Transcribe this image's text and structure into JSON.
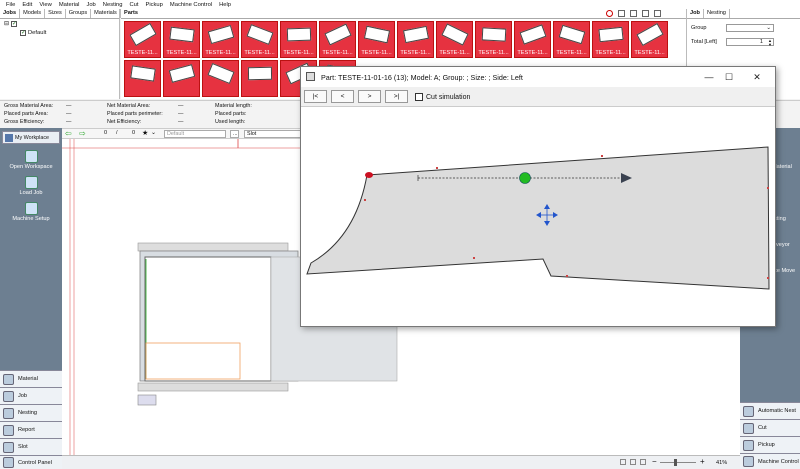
{
  "menu": [
    "File",
    "Edit",
    "View",
    "Material",
    "Job",
    "Nesting",
    "Cut",
    "Pickup",
    "Machine Control",
    "Help"
  ],
  "left_panel": {
    "tabs": [
      "Jobs",
      "Models",
      "Sizes",
      "Groups",
      "Materials"
    ],
    "tree_item": "Default"
  },
  "parts_panel": {
    "tab": "Parts",
    "thumb_label": "TESTE-11...",
    "thumb_count": 20
  },
  "job_panel": {
    "tabs": [
      "Job",
      "Nesting"
    ],
    "group_label": "Group",
    "total_left_label": "Total [Left]",
    "total_left_value": "1"
  },
  "stats": {
    "gross_material_area": "Gross Material Area:",
    "placed_parts_area": "Placed parts Area:",
    "gross_efficiency": "Gross Efficiency:",
    "net_material_area": "Net Material Area:",
    "placed_parts_perimeter": "Placed parts perimeter:",
    "net_efficiency": "Net Efficiency:",
    "material_length": "Material length:",
    "placed_parts": "Placed parts:",
    "used_length": "Used length:",
    "dash": "—"
  },
  "toolbar": {
    "count_a": "0",
    "sep": "/",
    "count_b": "0",
    "combo_default": "Default",
    "combo_slot": "Slot",
    "ellipsis": "..."
  },
  "left_nav": {
    "header": "My Workplace",
    "tools": [
      "Open Workspace",
      "Load Job",
      "Machine Setup"
    ],
    "buttons": [
      "Material",
      "Job",
      "Nesting",
      "Report",
      "Slot",
      "Control Panel"
    ]
  },
  "right_nav": {
    "partial_labels": [
      "Material",
      "sting",
      "veyor",
      "ce Move"
    ],
    "buttons": [
      "Automatic Nest",
      "Cut",
      "Pickup",
      "Machine Control"
    ]
  },
  "statusbar": {
    "zoom": "41%"
  },
  "dialog": {
    "title": "Part: TESTE-11-01-16 (13); Model: A; Group: ; Size: ; Side: Left",
    "buttons": [
      "|<",
      "<",
      ">",
      ">|"
    ],
    "cut_simulation": "Cut simulation",
    "colors": {
      "part_fill": "#dcdcdc",
      "start_point": "#cc1122",
      "center_point": "#22bb22",
      "move_icon": "#2255cc"
    }
  }
}
